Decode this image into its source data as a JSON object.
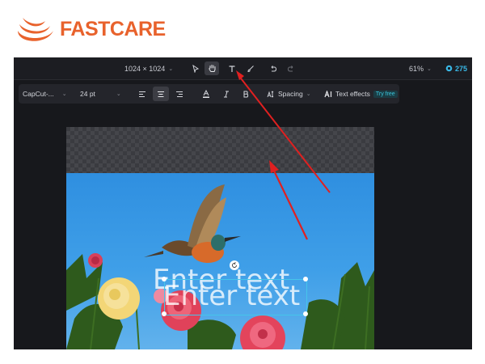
{
  "brand": {
    "name": "FASTCARE",
    "color": "#e8622c"
  },
  "topbar": {
    "canvas_size": "1024 × 1024",
    "tools": [
      "select-arrow-icon",
      "hand-icon",
      "text-icon",
      "brush-icon",
      "undo-icon",
      "redo-icon"
    ],
    "active_tool": "hand-icon",
    "zoom": "61%",
    "credits": "275"
  },
  "format_bar": {
    "font": "CapCut-...",
    "size": "24 pt",
    "align_active": "center",
    "spacing_label": "Spacing",
    "text_effects_label": "Text effects",
    "try_free": "Try free"
  },
  "canvas": {
    "text_a": "Enter text",
    "text_b": "Enter text"
  },
  "colors": {
    "accent": "#39b8e6",
    "arrow": "#e02020",
    "selection": "#46c5ea"
  }
}
